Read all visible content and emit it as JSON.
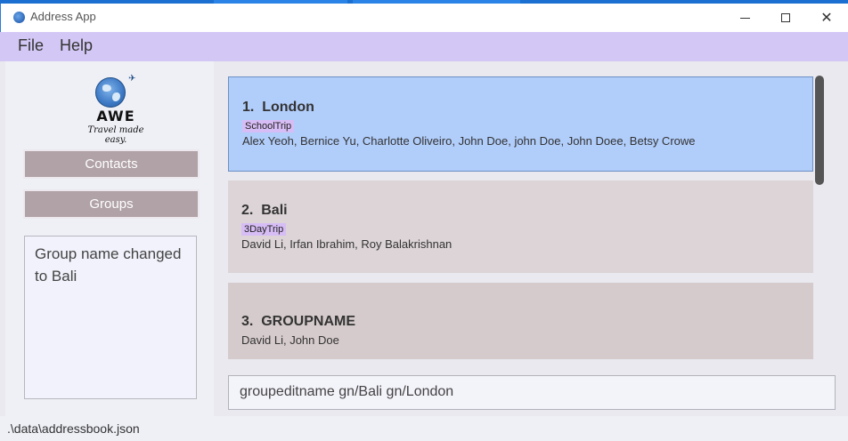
{
  "window": {
    "title": "Address App",
    "close_glyph": "✕"
  },
  "menu": {
    "file_label": "File",
    "help_label": "Help"
  },
  "sidebar": {
    "logo_wordmark": "AWE",
    "logo_tagline": "Travel made easy.",
    "contacts_label": "Contacts",
    "groups_label": "Groups",
    "result_text": "Group name changed to Bali"
  },
  "groups": [
    {
      "index": "1.",
      "name": "London",
      "tag": "SchoolTrip",
      "members": "Alex Yeoh, Bernice Yu, Charlotte Oliveiro, John Doe, john Doe, John Doee, Betsy Crowe",
      "selected": true
    },
    {
      "index": "2.",
      "name": "Bali",
      "tag": "3DayTrip",
      "members": "David Li, Irfan Ibrahim, Roy Balakrishnan",
      "selected": false
    },
    {
      "index": "3.",
      "name": "GROUPNAME",
      "tag": "",
      "members": "David Li, John Doe",
      "selected": false
    }
  ],
  "command": {
    "value": "groupeditname gn/Bali gn/London"
  },
  "status": {
    "path": ".\\data\\addressbook.json"
  },
  "colors": {
    "menu_bar": "#d3c8f5",
    "selected_card": "#b1cdfa",
    "card": "#dcd4d6",
    "nav_button": "#b0a2a6",
    "tag": "#d7bdf5"
  },
  "icons": {
    "app": "globe-icon",
    "minimize": "minimize-icon",
    "maximize": "maximize-icon",
    "close": "close-icon",
    "logo": "globe-logo-icon"
  }
}
